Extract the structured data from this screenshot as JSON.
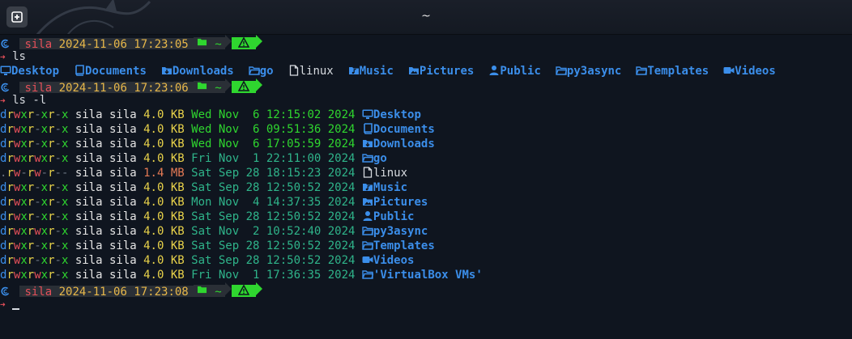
{
  "window": {
    "title": "~"
  },
  "prompts": [
    {
      "user": "sila",
      "datetime": "2024-11-06 17:23:05",
      "folder": "~",
      "command": "ls"
    },
    {
      "user": "sila",
      "datetime": "2024-11-06 17:23:06",
      "folder": "~",
      "command": "ls -l"
    },
    {
      "user": "sila",
      "datetime": "2024-11-06 17:23:08",
      "folder": "~",
      "command": ""
    }
  ],
  "ls_entries": [
    {
      "name": "Desktop",
      "type": "dir",
      "icon": "desktop-icon"
    },
    {
      "name": "Documents",
      "type": "dir",
      "icon": "book-icon"
    },
    {
      "name": "Downloads",
      "type": "dir",
      "icon": "download-folder-icon"
    },
    {
      "name": "go",
      "type": "dir",
      "icon": "folder-outline-icon"
    },
    {
      "name": "linux",
      "type": "file",
      "icon": "file-icon"
    },
    {
      "name": "Music",
      "type": "dir",
      "icon": "music-folder-icon"
    },
    {
      "name": "Pictures",
      "type": "dir",
      "icon": "image-folder-icon"
    },
    {
      "name": "Public",
      "type": "dir",
      "icon": "user-icon"
    },
    {
      "name": "py3async",
      "type": "dir",
      "icon": "folder-outline-icon"
    },
    {
      "name": "Templates",
      "type": "dir",
      "icon": "folder-outline-icon"
    },
    {
      "name": "Videos",
      "type": "dir",
      "icon": "video-icon"
    }
  ],
  "ls_l": [
    {
      "perm": "drwxr-xr-x",
      "owner": "sila",
      "group": "sila",
      "size": "4.0",
      "unit": "KB",
      "date": "Wed Nov  6 12:15:02 2024",
      "recent": true,
      "name": "Desktop",
      "icon": "desktop-icon",
      "type": "dir"
    },
    {
      "perm": "drwxr-xr-x",
      "owner": "sila",
      "group": "sila",
      "size": "4.0",
      "unit": "KB",
      "date": "Wed Nov  6 09:51:36 2024",
      "recent": true,
      "name": "Documents",
      "icon": "book-icon",
      "type": "dir"
    },
    {
      "perm": "drwxr-xr-x",
      "owner": "sila",
      "group": "sila",
      "size": "4.0",
      "unit": "KB",
      "date": "Wed Nov  6 17:05:59 2024",
      "recent": true,
      "name": "Downloads",
      "icon": "download-folder-icon",
      "type": "dir"
    },
    {
      "perm": "drwxrwxr-x",
      "owner": "sila",
      "group": "sila",
      "size": "4.0",
      "unit": "KB",
      "date": "Fri Nov  1 22:11:00 2024",
      "recent": false,
      "name": "go",
      "icon": "folder-outline-icon",
      "type": "dir"
    },
    {
      "perm": ".rw-rw-r--",
      "owner": "sila",
      "group": "sila",
      "size": "1.4",
      "unit": "MB",
      "date": "Sat Sep 28 18:15:23 2024",
      "recent": false,
      "name": "linux",
      "icon": "file-icon",
      "type": "file"
    },
    {
      "perm": "drwxr-xr-x",
      "owner": "sila",
      "group": "sila",
      "size": "4.0",
      "unit": "KB",
      "date": "Sat Sep 28 12:50:52 2024",
      "recent": false,
      "name": "Music",
      "icon": "music-folder-icon",
      "type": "dir"
    },
    {
      "perm": "drwxr-xr-x",
      "owner": "sila",
      "group": "sila",
      "size": "4.0",
      "unit": "KB",
      "date": "Mon Nov  4 14:37:35 2024",
      "recent": false,
      "name": "Pictures",
      "icon": "image-folder-icon",
      "type": "dir"
    },
    {
      "perm": "drwxr-xr-x",
      "owner": "sila",
      "group": "sila",
      "size": "4.0",
      "unit": "KB",
      "date": "Sat Sep 28 12:50:52 2024",
      "recent": false,
      "name": "Public",
      "icon": "user-icon",
      "type": "dir"
    },
    {
      "perm": "drwxrwxr-x",
      "owner": "sila",
      "group": "sila",
      "size": "4.0",
      "unit": "KB",
      "date": "Sat Nov  2 10:52:40 2024",
      "recent": false,
      "name": "py3async",
      "icon": "folder-outline-icon",
      "type": "dir"
    },
    {
      "perm": "drwxr-xr-x",
      "owner": "sila",
      "group": "sila",
      "size": "4.0",
      "unit": "KB",
      "date": "Sat Sep 28 12:50:52 2024",
      "recent": false,
      "name": "Templates",
      "icon": "folder-outline-icon",
      "type": "dir"
    },
    {
      "perm": "drwxr-xr-x",
      "owner": "sila",
      "group": "sila",
      "size": "4.0",
      "unit": "KB",
      "date": "Sat Sep 28 12:50:52 2024",
      "recent": false,
      "name": "Videos",
      "icon": "video-icon",
      "type": "dir"
    },
    {
      "perm": "drwxrwxr-x",
      "owner": "sila",
      "group": "sila",
      "size": "4.0",
      "unit": "KB",
      "date": "Fri Nov  1 17:36:35 2024",
      "recent": false,
      "name": "'VirtualBox VMs'",
      "icon": "folder-outline-icon",
      "type": "dir"
    }
  ],
  "colors": {
    "background": "#0f151f",
    "directory": "#3b8eea",
    "user": "#e5505a",
    "datetime": "#e8b84a",
    "accent_green": "#2fd62f"
  }
}
